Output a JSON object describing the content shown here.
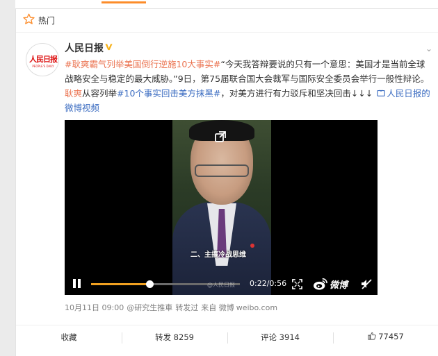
{
  "hot_section": {
    "label": "热门"
  },
  "post": {
    "author": "人民日报",
    "avatar_text": {
      "title": "人民日报",
      "subtitle": "PEOPLE'S DAILY"
    },
    "content": {
      "p1_topic": "#耿爽霸气列举美国倒行逆施10大事实#",
      "p1_text": "“今天我答辩要说的只有一个意思：美国才是当前全球战略安全与稳定的最大威胁。”9日，第75届联合国大会裁军与国际安全委员会举行一般性辩论。",
      "p2_name": "耿爽",
      "p2_text1": "从容列举",
      "p2_hash": "#10个事实回击美方抹黑#",
      "p2_text2": "，对美方进行有力驳斥和坚决回击↓↓↓",
      "video_link": "人民日报的微博视频"
    },
    "video": {
      "subtitle": "二、主搞冷战思维",
      "time": "0:22/0:56",
      "progress": 0.393,
      "brand": "微博",
      "watermark": "@人民日报"
    },
    "meta": {
      "date": "10月11日 09:00",
      "editor": "@研究生推車",
      "repost_label": "转发过",
      "source": "来自 微博",
      "domain": "weibo.com"
    },
    "actions": {
      "collect": "收藏",
      "repost": "转发 8259",
      "comment": "评论 3914",
      "like": "77457"
    }
  },
  "colors": {
    "accent": "#eb7350",
    "link": "#3b6cc1",
    "progress": "#f0a020",
    "brand_orange": "#fc8c2a"
  }
}
